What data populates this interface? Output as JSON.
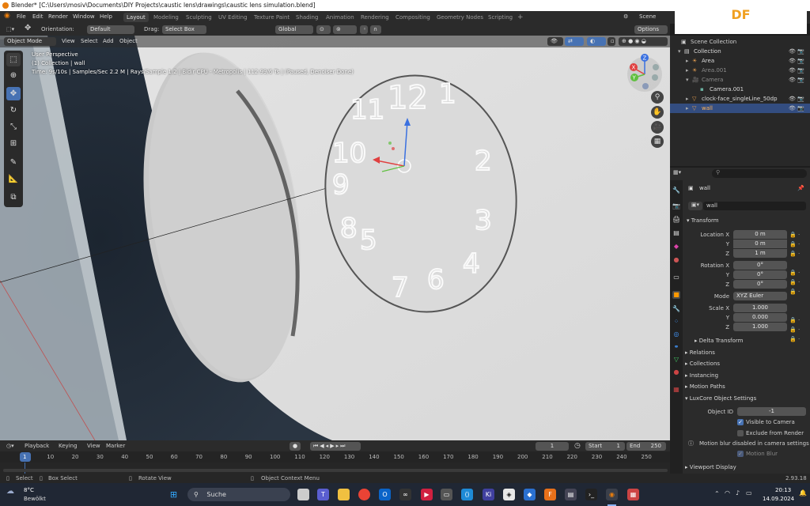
{
  "window": {
    "title": "Blender* [C:\\Users\\mosiv\\Documents\\DIY Projects\\caustic lens\\drawings\\caustic lens simulation.blend]"
  },
  "badge": "DF",
  "menu": [
    "File",
    "Edit",
    "Render",
    "Window",
    "Help"
  ],
  "workspaces": [
    "Layout",
    "Modeling",
    "Sculpting",
    "UV Editing",
    "Texture Paint",
    "Shading",
    "Animation",
    "Rendering",
    "Compositing",
    "Geometry Nodes",
    "Scripting"
  ],
  "workspace_add": "+",
  "scene_label": "Scene",
  "tool_header": {
    "orientation_label": "Orientation:",
    "orientation": "Default",
    "drag_label": "Drag:",
    "drag": "Select Box",
    "transform_orientation": "Global",
    "options": "Options"
  },
  "viewport_header": {
    "mode": "Object Mode",
    "menus": [
      "View",
      "Select",
      "Add",
      "Object"
    ]
  },
  "viewport_info": {
    "line1": "User Perspective",
    "line2": "(1) Collection | wall",
    "line3": "Time: 9s/10s | Samples/Sec 2.2 M | Rays/Sample 1.2 | Bidir CPU - Metropolis | 112.99/6 Ts | (Paused, Denoiser Done)"
  },
  "gizmo": {
    "x": "X",
    "y": "Y",
    "z": "Z"
  },
  "outliner": {
    "root": "Scene Collection",
    "items": [
      {
        "label": "Collection",
        "level": 1,
        "icon": "collection-icon",
        "selected": false,
        "dim": false
      },
      {
        "label": "Area",
        "level": 2,
        "icon": "light-icon",
        "selected": false,
        "dim": false
      },
      {
        "label": "Area.001",
        "level": 2,
        "icon": "light-icon",
        "selected": false,
        "dim": true
      },
      {
        "label": "Camera",
        "level": 2,
        "icon": "camera-icon",
        "selected": false,
        "dim": true
      },
      {
        "label": "Camera.001",
        "level": 3,
        "icon": "camera-data-icon",
        "selected": false,
        "dim": false
      },
      {
        "label": "clock-face_singleLine_50dp",
        "level": 2,
        "icon": "mesh-icon",
        "selected": false,
        "dim": false
      },
      {
        "label": "wall",
        "level": 2,
        "icon": "mesh-icon",
        "selected": true,
        "dim": false
      }
    ]
  },
  "properties": {
    "object_name": "wall",
    "datablock": "wall",
    "transform_title": "Transform",
    "location_label": "Location X",
    "location": [
      "0 m",
      "0 m",
      "1 m"
    ],
    "rotation_label": "Rotation X",
    "rotation": [
      "0°",
      "0°",
      "0°"
    ],
    "mode_label": "Mode",
    "mode": "XYZ Euler",
    "scale_label": "Scale X",
    "scale": [
      "1.000",
      "0.000",
      "1.000"
    ],
    "axis_y": "Y",
    "axis_z": "Z",
    "delta": "Delta Transform",
    "sections": [
      "Relations",
      "Collections",
      "Instancing",
      "Motion Paths"
    ],
    "luxcore_title": "LuxCore Object Settings",
    "object_id_label": "Object ID",
    "object_id": "-1",
    "visible_to_camera": "Visible to Camera",
    "exclude_from_render": "Exclude from Render",
    "motion_blur_note": "Motion blur disabled in camera settings",
    "motion_blur": "Motion Blur",
    "viewport_display": "Viewport Display"
  },
  "timeline": {
    "menus": [
      "Playback",
      "Keying",
      "View",
      "Marker"
    ],
    "current_frame": "1",
    "start_label": "Start",
    "start": "1",
    "end_label": "End",
    "end": "250",
    "ticks": [
      "1",
      "10",
      "20",
      "30",
      "40",
      "50",
      "60",
      "70",
      "80",
      "90",
      "100",
      "110",
      "120",
      "130",
      "140",
      "150",
      "160",
      "170",
      "180",
      "190",
      "200",
      "210",
      "220",
      "230",
      "240",
      "250"
    ]
  },
  "status_bar": {
    "select": "Select",
    "box_select": "Box Select",
    "rotate": "Rotate View",
    "context": "Object Context Menu",
    "version": "2.93.18"
  },
  "taskbar": {
    "weather_temp": "8°C",
    "weather_desc": "Bewölkt",
    "search": "Suche",
    "time": "20:13",
    "date": "14.09.2024"
  },
  "clock_numbers": [
    "11",
    "12",
    "1",
    "10",
    "2",
    "9",
    "3",
    "8",
    "4",
    "7",
    "6",
    "5"
  ],
  "colors": {
    "accent": "#4772b3",
    "blender_orange": "#e87d0d",
    "selection": "#334d80"
  }
}
